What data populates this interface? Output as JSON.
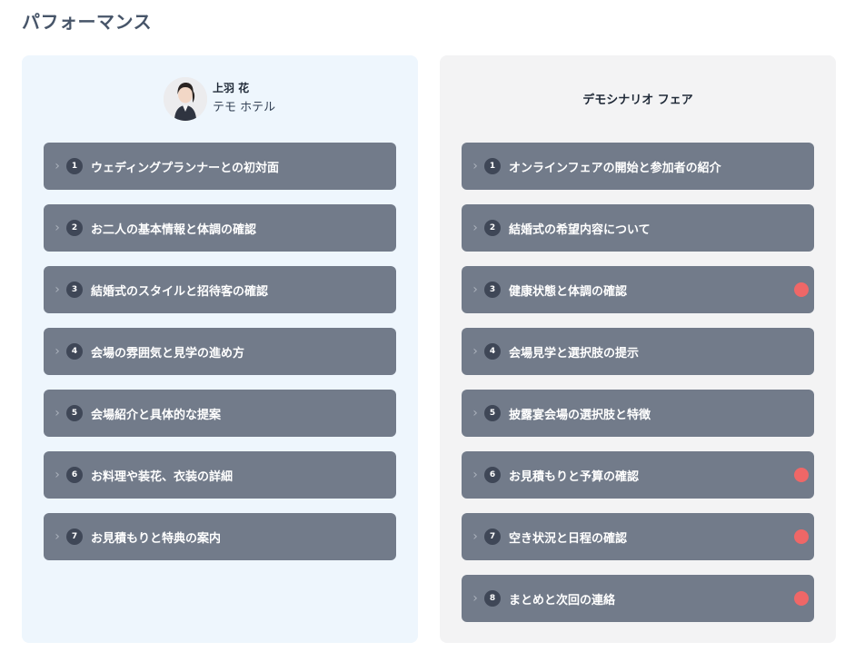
{
  "page": {
    "title": "パフォーマンス"
  },
  "left_panel": {
    "user": {
      "name": "上羽 花",
      "org": "テモ ホテル",
      "avatar_icon": "person-avatar-icon"
    },
    "steps": [
      {
        "number": "1",
        "label": "ウェディングプランナーとの初対面"
      },
      {
        "number": "2",
        "label": "お二人の基本情報と体調の確認"
      },
      {
        "number": "3",
        "label": "結婚式のスタイルと招待客の確認"
      },
      {
        "number": "4",
        "label": "会場の雰囲気と見学の進め方"
      },
      {
        "number": "5",
        "label": "会場紹介と具体的な提案"
      },
      {
        "number": "6",
        "label": "お料理や装花、衣装の詳細"
      },
      {
        "number": "7",
        "label": "お見積もりと特典の案内"
      }
    ]
  },
  "right_panel": {
    "title": "デモシナリオ フェア",
    "steps": [
      {
        "number": "1",
        "label": "オンラインフェアの開始と参加者の紹介",
        "flagged": false
      },
      {
        "number": "2",
        "label": "結婚式の希望内容について",
        "flagged": false
      },
      {
        "number": "3",
        "label": "健康状態と体調の確認",
        "flagged": true
      },
      {
        "number": "4",
        "label": "会場見学と選択肢の提示",
        "flagged": false
      },
      {
        "number": "5",
        "label": "披露宴会場の選択肢と特徴",
        "flagged": false
      },
      {
        "number": "6",
        "label": "お見積もりと予算の確認",
        "flagged": true
      },
      {
        "number": "7",
        "label": "空き状況と日程の確認",
        "flagged": true
      },
      {
        "number": "8",
        "label": "まとめと次回の連絡",
        "flagged": true
      }
    ]
  },
  "colors": {
    "flag": "#ef6767",
    "step_bg": "#727b8a",
    "left_panel_bg": "#eef6fd",
    "right_panel_bg": "#f3f3f4"
  },
  "icons": {
    "chevron": "chevron-right-icon",
    "flag": "red-dot-icon"
  }
}
